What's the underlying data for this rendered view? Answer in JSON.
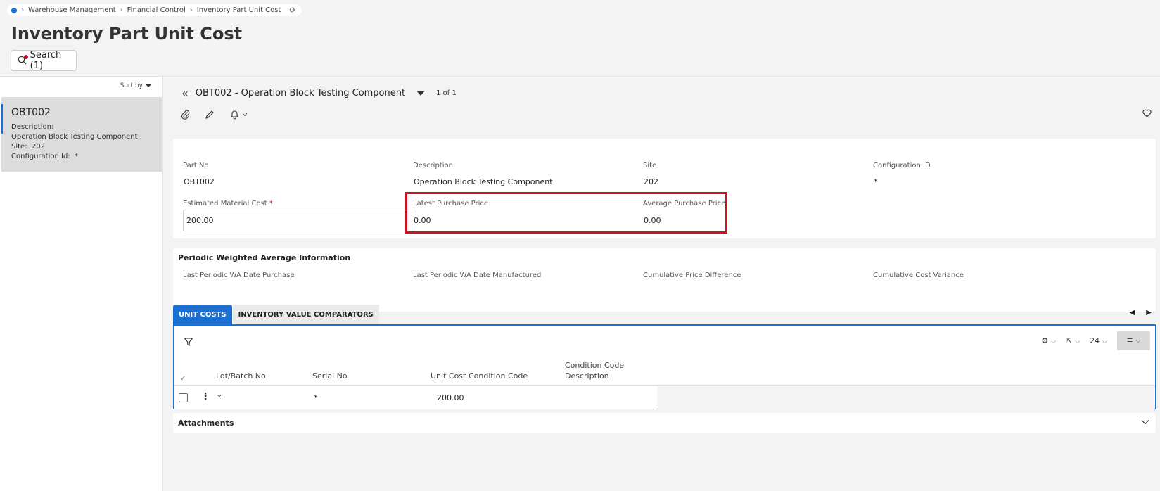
{
  "breadcrumb": {
    "items": [
      "Warehouse Management",
      "Financial Control",
      "Inventory Part Unit Cost"
    ]
  },
  "page": {
    "title": "Inventory Part Unit Cost",
    "search_label": "Search (1)"
  },
  "sidebar": {
    "sort_label": "Sort by",
    "record": {
      "id": "OBT002",
      "description_label": "Description:",
      "description": "Operation Block Testing Component",
      "site_label": "Site:",
      "site": "202",
      "config_label": "Configuration Id:",
      "config": "*"
    }
  },
  "record_header": {
    "title": "OBT002 - Operation Block Testing Component",
    "count": "1 of 1"
  },
  "details": {
    "part_no_label": "Part No",
    "part_no": "OBT002",
    "description_label": "Description",
    "description": "Operation Block Testing Component",
    "site_label": "Site",
    "site": "202",
    "config_label": "Configuration ID",
    "config": "*",
    "est_cost_label": "Estimated Material Cost",
    "est_cost_required": "*",
    "est_cost": "200.00",
    "latest_price_label": "Latest Purchase Price",
    "latest_price": "0.00",
    "avg_price_label": "Average Purchase Price",
    "avg_price": "0.00"
  },
  "pwa": {
    "title": "Periodic Weighted Average Information",
    "last_purchase_label": "Last Periodic WA Date Purchase",
    "last_manufactured_label": "Last Periodic WA Date Manufactured",
    "cum_price_diff_label": "Cumulative Price Difference",
    "cum_cost_var_label": "Cumulative Cost Variance"
  },
  "tabs": [
    "UNIT COSTS",
    "INVENTORY VALUE COMPARATORS"
  ],
  "grid": {
    "page_size": "24",
    "columns": {
      "lot": "Lot/Batch No",
      "serial": "Serial No",
      "unit_cost": "Unit Cost",
      "condition": "Condition Code",
      "condition_desc_1": "Condition Code",
      "condition_desc_2": "Description"
    },
    "rows": [
      {
        "lot": "*",
        "serial": "*",
        "unit_cost": "200.00",
        "condition": "",
        "condition_desc": ""
      }
    ]
  },
  "attachments": {
    "label": "Attachments"
  },
  "colors": {
    "accent": "#1a6fd1",
    "highlight": "#d2131f",
    "required": "#c8102e"
  }
}
